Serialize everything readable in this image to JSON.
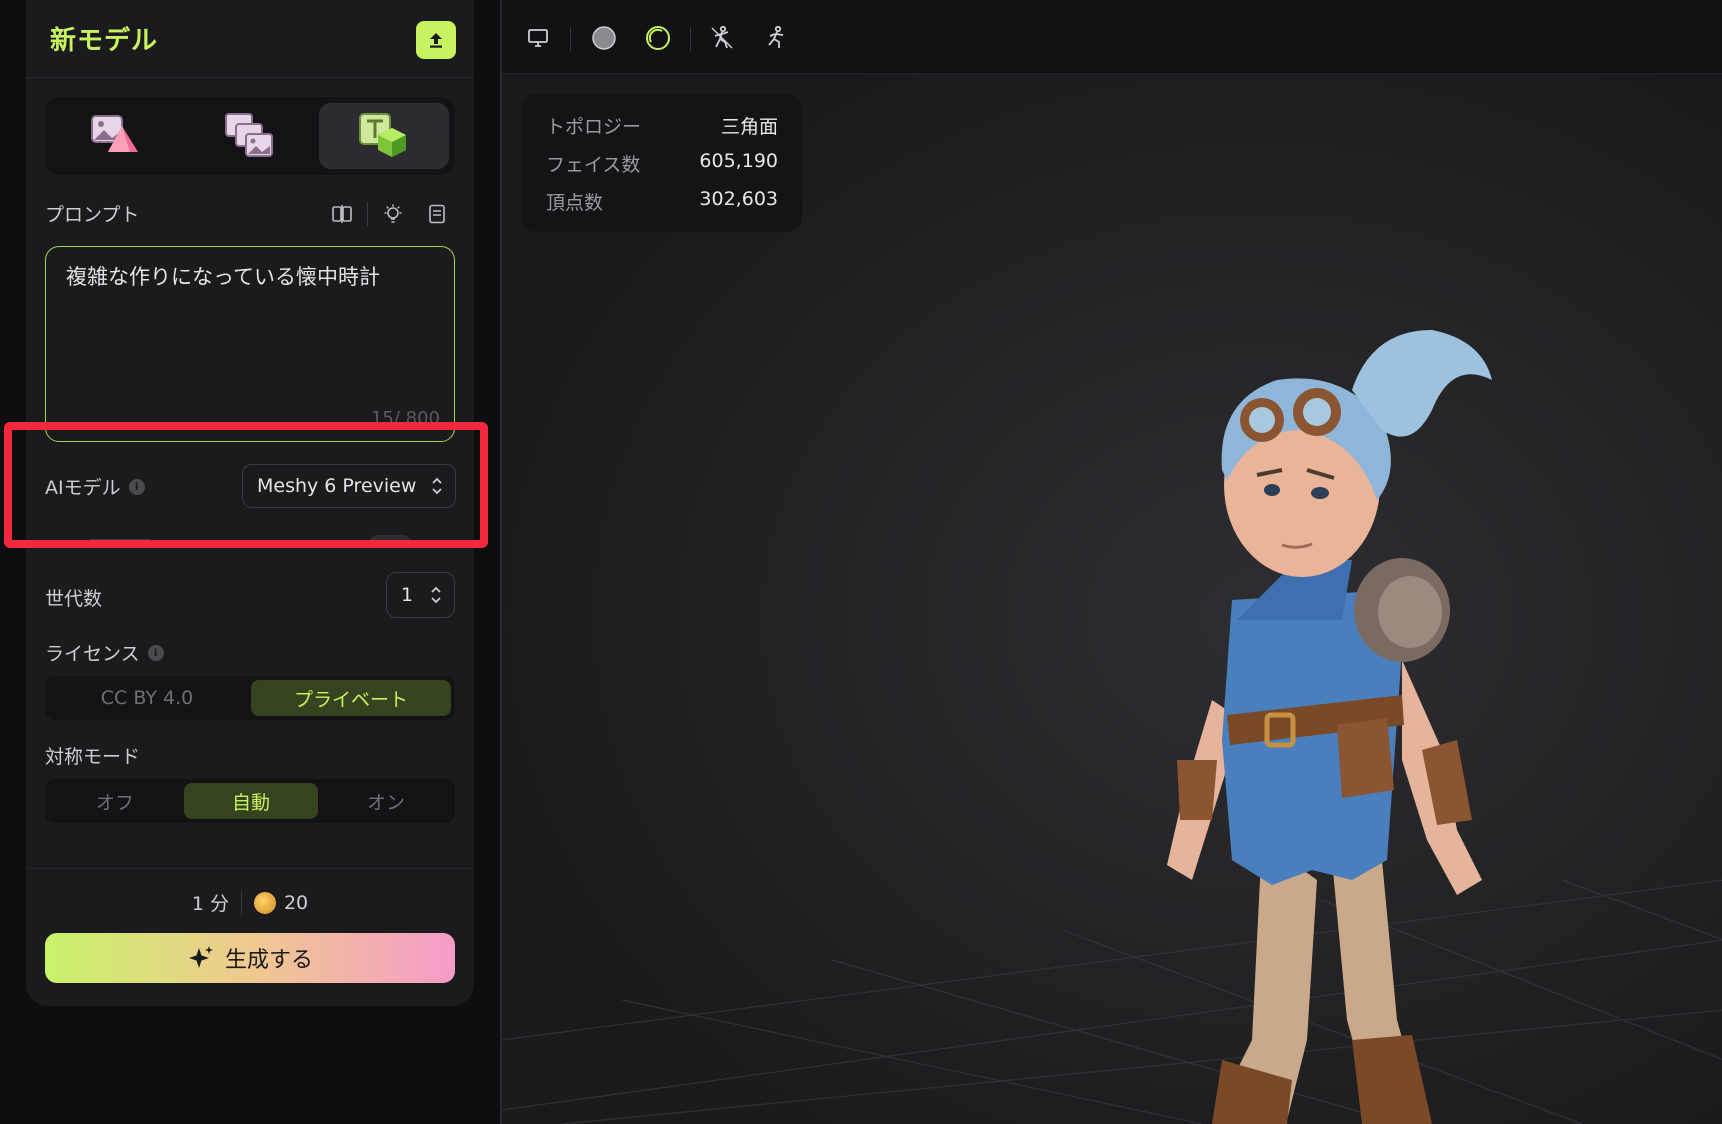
{
  "panel": {
    "title": "新モデル",
    "prompt": {
      "label": "プロンプト",
      "text": "複雑な作りになっている懐中時計",
      "count": "15/ 800"
    },
    "ai_model": {
      "label": "AIモデル",
      "value": "Meshy 6 Preview"
    },
    "generations": {
      "label": "世代数",
      "value": "1"
    },
    "license": {
      "label": "ライセンス",
      "options": [
        "CC BY 4.0",
        "プライベート"
      ],
      "selected": "プライベート"
    },
    "symmetry": {
      "label": "対称モード",
      "options": [
        "オフ",
        "自動",
        "オン"
      ],
      "selected": "自動"
    },
    "footer": {
      "time": "1 分",
      "credits": "20",
      "generate_label": "生成する"
    }
  },
  "viewport": {
    "stats": [
      {
        "key": "トポロジー",
        "value": "三角面"
      },
      {
        "key": "フェイス数",
        "value": "605,190"
      },
      {
        "key": "頂点数",
        "value": "302,603"
      }
    ]
  },
  "colors": {
    "accent": "#c8f25f",
    "highlight": "#f2283c"
  }
}
